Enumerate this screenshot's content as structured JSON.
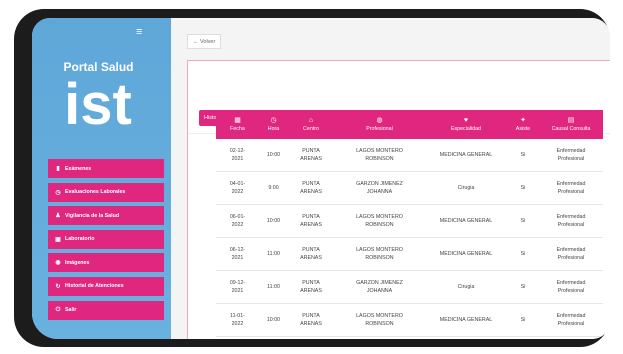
{
  "sidebar": {
    "portal_title": "Portal Salud",
    "logo_text": "ist",
    "hamburger": "≡",
    "items": [
      {
        "label": "Exámenes",
        "icon": "document-icon",
        "glyph": "▮"
      },
      {
        "label": "Evaluaciones Laborales",
        "icon": "clock-icon",
        "glyph": "◷"
      },
      {
        "label": "Vigilancia de la Salud",
        "icon": "user-icon",
        "glyph": "♟"
      },
      {
        "label": "Laboratorio",
        "icon": "calendar-icon",
        "glyph": "▣"
      },
      {
        "label": "Imágenes",
        "icon": "eye-icon",
        "glyph": "◉"
      },
      {
        "label": "Historial de Atenciones",
        "icon": "refresh-icon",
        "glyph": "↻"
      },
      {
        "label": "Salir",
        "icon": "power-icon",
        "glyph": "⏻"
      }
    ]
  },
  "main": {
    "back_label": "← Volver",
    "tab_label": "Historial",
    "columns": [
      {
        "label": "Fecha",
        "icon": "calendar-icon",
        "glyph": "▦"
      },
      {
        "label": "Hora",
        "icon": "clock-icon",
        "glyph": "◷"
      },
      {
        "label": "Centro",
        "icon": "building-icon",
        "glyph": "⌂"
      },
      {
        "label": "Profesional",
        "icon": "user-icon",
        "glyph": "◍"
      },
      {
        "label": "Especialidad",
        "icon": "heart-icon",
        "glyph": "♥"
      },
      {
        "label": "Asiste",
        "icon": "check-icon",
        "glyph": "✦"
      },
      {
        "label": "Causal Consulta",
        "icon": "clipboard-icon",
        "glyph": "▤"
      }
    ],
    "rows": [
      {
        "fecha": "02-12-\n2021",
        "hora": "10:00",
        "centro": "PUNTA\nARENAS",
        "profesional": "LAGOS MONTERO\nROBINSON",
        "especialidad": "MEDICINA GENERAL",
        "asiste": "Si",
        "causal": "Enfermedad\nProfesional"
      },
      {
        "fecha": "04-01-\n2022",
        "hora": "9:00",
        "centro": "PUNTA\nARENAS",
        "profesional": "GARZON JIMENEZ\nJOHANNA",
        "especialidad": "Cirugia",
        "asiste": "Si",
        "causal": "Enfermedad\nProfesional"
      },
      {
        "fecha": "06-01-\n2022",
        "hora": "10:00",
        "centro": "PUNTA\nARENAS",
        "profesional": "LAGOS MONTERO\nROBINSON",
        "especialidad": "MEDICINA GENERAL",
        "asiste": "Si",
        "causal": "Enfermedad\nProfesional"
      },
      {
        "fecha": "06-12-\n2021",
        "hora": "11:00",
        "centro": "PUNTA\nARENAS",
        "profesional": "LAGOS MONTERO\nROBINSON",
        "especialidad": "MEDICINA GENERAL",
        "asiste": "Si",
        "causal": "Enfermedad\nProfesional"
      },
      {
        "fecha": "09-12-\n2021",
        "hora": "11:00",
        "centro": "PUNTA\nARENAS",
        "profesional": "GARZON JIMENEZ\nJOHANNA",
        "especialidad": "Cirugia",
        "asiste": "Si",
        "causal": "Enfermedad\nProfesional"
      },
      {
        "fecha": "11-01-\n2022",
        "hora": "10:00",
        "centro": "PUNTA\nARENAS",
        "profesional": "LAGOS MONTERO\nROBINSON",
        "especialidad": "MEDICINA GENERAL",
        "asiste": "Si",
        "causal": "Enfermedad\nProfesional"
      }
    ]
  },
  "colors": {
    "accent": "#e0277f",
    "sidebar": "#64acdc"
  }
}
